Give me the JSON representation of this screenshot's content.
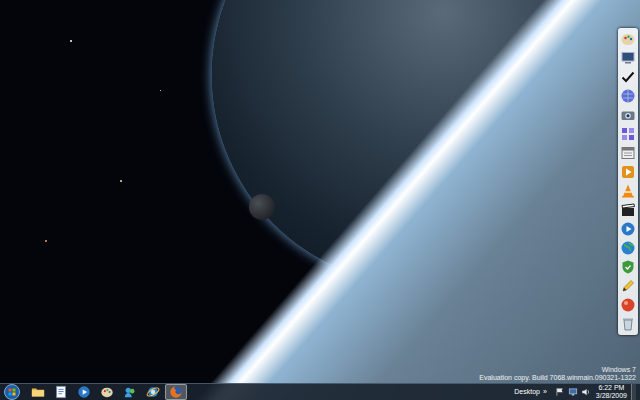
{
  "watermark": {
    "lines": [
      "Windows 7",
      "Evaluation copy. Build 7068.winmain.090321-1322"
    ]
  },
  "dock": {
    "items": [
      {
        "kind": "paint"
      },
      {
        "kind": "computer"
      },
      {
        "kind": "check"
      },
      {
        "kind": "globe"
      },
      {
        "kind": "camera"
      },
      {
        "kind": "grid"
      },
      {
        "kind": "calendar"
      },
      {
        "kind": "play"
      },
      {
        "kind": "vlc"
      },
      {
        "kind": "clapper"
      },
      {
        "kind": "media"
      },
      {
        "kind": "earth"
      },
      {
        "kind": "shield"
      },
      {
        "kind": "pencil"
      },
      {
        "kind": "ball"
      },
      {
        "kind": "recycle"
      }
    ]
  },
  "taskbar": {
    "start_button": {
      "kind": "start"
    },
    "apps": [
      {
        "kind": "explorer",
        "active": false
      },
      {
        "kind": "document",
        "active": false
      },
      {
        "kind": "media",
        "active": false
      },
      {
        "kind": "paint",
        "active": false
      },
      {
        "kind": "messenger",
        "active": false
      },
      {
        "kind": "ie",
        "active": false
      },
      {
        "kind": "firefox",
        "active": true
      }
    ],
    "toolbar": {
      "label": "Desktop",
      "chevron": "»"
    },
    "tray": [
      {
        "kind": "flag"
      },
      {
        "kind": "network"
      },
      {
        "kind": "volume"
      }
    ],
    "clock": {
      "time": "6:22 PM",
      "date": "3/28/2009"
    }
  }
}
